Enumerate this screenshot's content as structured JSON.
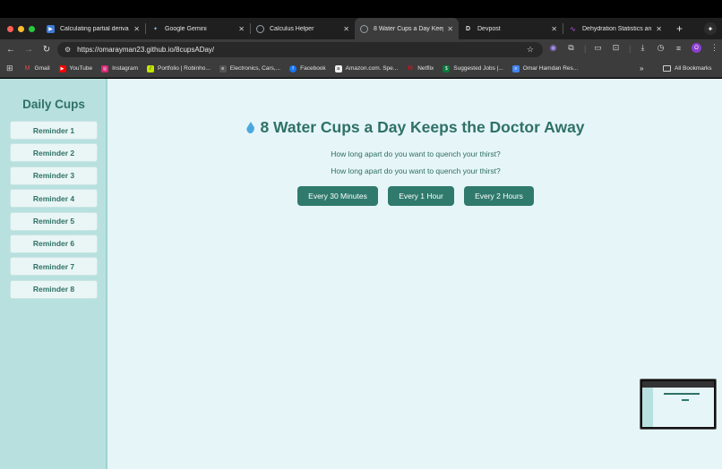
{
  "browser": {
    "tabs": [
      {
        "title": "Calculating partial deriva",
        "icon": "youtube-icon",
        "color": "#3d7bd9"
      },
      {
        "title": "Google Gemini",
        "icon": "gemini-icon",
        "color": "#8ab4f8"
      },
      {
        "title": "Calculus Helper",
        "icon": "globe-icon",
        "color": "#9aa0a6"
      },
      {
        "title": "8 Water Cups a Day Keep",
        "icon": "globe-icon",
        "color": "#9aa0a6",
        "active": true
      },
      {
        "title": "Devpost",
        "icon": "devpost-icon",
        "color": "#1f1f1f"
      },
      {
        "title": "Dehydration Statistics an",
        "icon": "chart-icon",
        "color": "#b45ae0"
      }
    ],
    "url": "https://omarayman23.github.io/8cupsADay/",
    "profile_initial": "O",
    "bookmarks": [
      {
        "label": "Gmail",
        "color": "#ea4335"
      },
      {
        "label": "YouTube",
        "color": "#ff0000"
      },
      {
        "label": "Instagram",
        "color": "#d62976"
      },
      {
        "label": "Portfolio | Robinho...",
        "color": "#c4e600"
      },
      {
        "label": "Electronics, Cars,...",
        "color": "#555555"
      },
      {
        "label": "Facebook",
        "color": "#1877f2"
      },
      {
        "label": "Amazon.com. Spe...",
        "color": "#222222"
      },
      {
        "label": "Netflix",
        "color": "#e50914"
      },
      {
        "label": "Suggested Jobs |...",
        "color": "#0a7a3a"
      },
      {
        "label": "Omar Hamdan Res...",
        "color": "#4285f4"
      }
    ],
    "more_label": "»",
    "all_bookmarks_label": "All Bookmarks"
  },
  "sidebar": {
    "title": "Daily Cups",
    "reminders": [
      "Reminder 1",
      "Reminder 2",
      "Reminder 3",
      "Reminder 4",
      "Reminder 5",
      "Reminder 6",
      "Reminder 7",
      "Reminder 8"
    ]
  },
  "main": {
    "heading": "8 Water Cups a Day Keeps the Doctor Away",
    "question_1": "How long apart do you want to quench your thirst?",
    "question_2": "How long apart do you want to quench your thirst?",
    "buttons": [
      "Every 30 Minutes",
      "Every 1 Hour",
      "Every 2 Hours"
    ]
  },
  "colors": {
    "accent": "#2f7a6d",
    "sidebar_bg": "#b8e0df",
    "page_bg": "#e6f6f8"
  }
}
